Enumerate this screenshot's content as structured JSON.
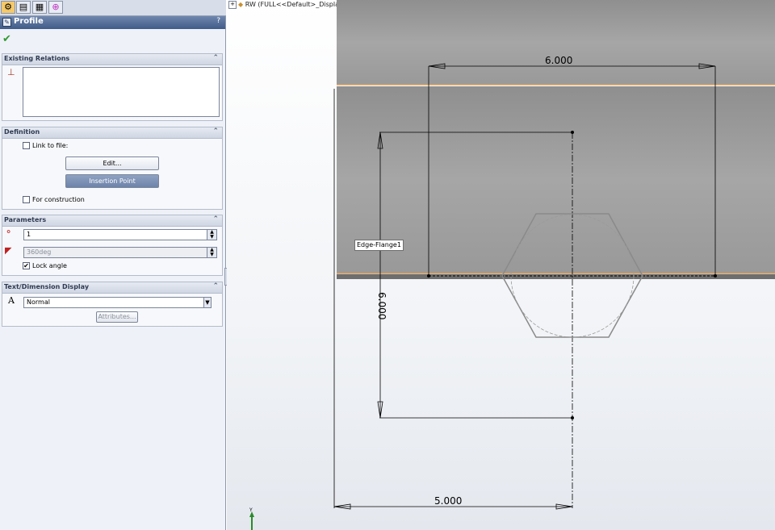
{
  "panel": {
    "tabs": [
      {
        "icon": "feature-manager-icon",
        "glyph": "⚙"
      },
      {
        "icon": "property-manager-icon",
        "glyph": "▤"
      },
      {
        "icon": "configuration-manager-icon",
        "glyph": "▦"
      },
      {
        "icon": "dimxpert-icon",
        "glyph": "⊕"
      }
    ],
    "title": "Profile",
    "help": "?",
    "existing_relations": {
      "title": "Existing Relations"
    },
    "definition": {
      "title": "Definition",
      "link_to_file": "Link to file:",
      "edit_button": "Edit...",
      "insertion_point_button": "Insertion Point",
      "for_construction": "For construction"
    },
    "parameters": {
      "title": "Parameters",
      "count_value": "1",
      "angle_value": "360deg",
      "lock_angle": "Lock angle",
      "lock_angle_checked": "✔"
    },
    "text_display": {
      "title": "Text/Dimension Display",
      "font_icon": "A",
      "style_value": "Normal",
      "attributes_button": "Attributes..."
    }
  },
  "viewport": {
    "tree_label": "RW  (FULL<<Default>_Displa...",
    "tooltip": "Edge-Flange1",
    "dimensions": {
      "top": "6.000",
      "left": "6.000",
      "bottom": "5.000"
    },
    "colors": {
      "plate": "#9c9c9c",
      "edge": "#d8a060",
      "sketch": "#000000",
      "hexagon": "#8a8a8a"
    }
  }
}
